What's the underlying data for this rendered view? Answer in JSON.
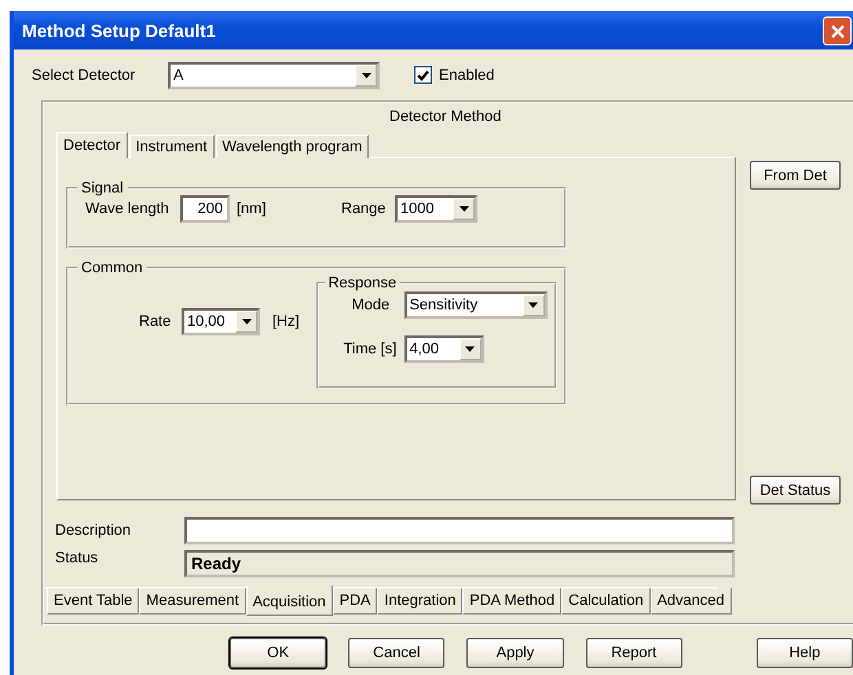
{
  "window": {
    "title": "Method Setup Default1"
  },
  "detector": {
    "label": "Select Detector",
    "value": "A",
    "enabled": {
      "label": "Enabled",
      "checked": true
    }
  },
  "method": {
    "title": "Detector Method",
    "tabs": [
      {
        "label": "Detector",
        "selected": true
      },
      {
        "label": "Instrument",
        "selected": false
      },
      {
        "label": "Wavelength program",
        "selected": false
      }
    ],
    "signal": {
      "title": "Signal",
      "wavelength": {
        "label": "Wave length",
        "value": "200",
        "unit": "[nm]"
      },
      "range": {
        "label": "Range",
        "value": "1000"
      }
    },
    "common": {
      "title": "Common",
      "rate": {
        "label": "Rate",
        "value": "10,00",
        "unit": "[Hz]"
      },
      "response": {
        "title": "Response",
        "mode": {
          "label": "Mode",
          "value": "Sensitivity"
        },
        "time": {
          "label": "Time [s]",
          "value": "4,00"
        }
      }
    },
    "side_buttons": [
      "From Det",
      "Det Status"
    ],
    "description": {
      "label": "Description"
    },
    "status": {
      "label": "Status",
      "value": "Ready"
    },
    "bottom_tabs": [
      {
        "label": "Event Table",
        "selected": false
      },
      {
        "label": "Measurement",
        "selected": false
      },
      {
        "label": "Acquisition",
        "selected": true
      },
      {
        "label": "PDA",
        "selected": false
      },
      {
        "label": "Integration",
        "selected": false
      },
      {
        "label": "PDA Method",
        "selected": false
      },
      {
        "label": "Calculation",
        "selected": false
      },
      {
        "label": "Advanced",
        "selected": false
      }
    ]
  },
  "buttons": [
    "OK",
    "Cancel",
    "Apply",
    "Report",
    "Help"
  ]
}
